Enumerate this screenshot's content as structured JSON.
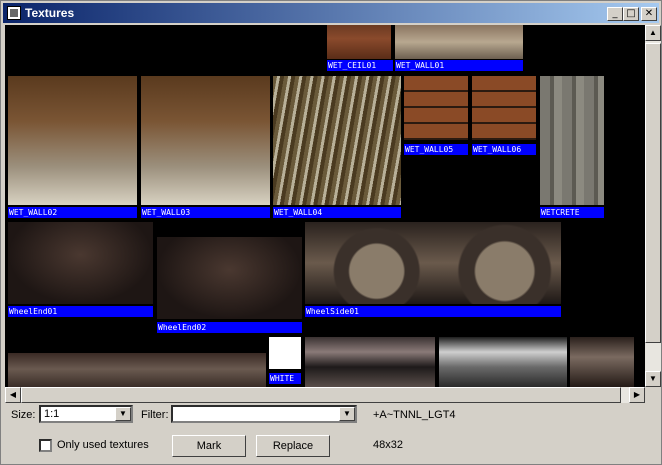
{
  "window": {
    "title": "Textures",
    "min_label": "_",
    "max_label": "□",
    "close_label": "✕"
  },
  "textures": [
    {
      "id": "wet_ceil01",
      "label": "WET_CEIL01",
      "bg": "linear-gradient(180deg,#6b3a22,#8a4a2c 40%,#5a2d18)"
    },
    {
      "id": "wet_wall01",
      "label": "WET_WALL01",
      "bg": "linear-gradient(180deg,#8a7560,#b8a890 50%,#6d6050)"
    },
    {
      "id": "wet_wall02",
      "label": "WET_WALL02",
      "bg": "linear-gradient(180deg,#5a3a1e,#7a5534 35%,#9b8f7c 70%,#d8d2c2)"
    },
    {
      "id": "wet_wall03",
      "label": "WET_WALL03",
      "bg": "linear-gradient(180deg,#5a3a1e,#7a5534 35%,#9b8f7c 70%,#d8d2c2)"
    },
    {
      "id": "wet_wall04",
      "label": "WET_WALL04",
      "bg": "repeating-linear-gradient(100deg,#6a5a3a 0 4px,#b8b098 4px 7px,#4a3a20 7px 11px)"
    },
    {
      "id": "wet_wall05",
      "label": "WET_WALL05",
      "bg": "repeating-linear-gradient(0deg,#2a1a10 0 2px,#8a4a26 2px 16px)"
    },
    {
      "id": "wet_wall06",
      "label": "WET_WALL06",
      "bg": "repeating-linear-gradient(0deg,#2a1a10 0 2px,#8a4a26 2px 16px)"
    },
    {
      "id": "wetcrete",
      "label": "WETCRETE",
      "bg": "repeating-linear-gradient(90deg,#7a7870 0 10px,#5c5a52 10px 14px,#8c8a80 14px 22px)"
    },
    {
      "id": "wheelend01",
      "label": "WheelEnd01",
      "bg": "radial-gradient(ellipse at 50% 40%,#4a3830,#1e1614 70%)"
    },
    {
      "id": "wheelend02",
      "label": "WheelEnd02",
      "bg": "radial-gradient(ellipse at 50% 40%,#4a3830,#1e1614 70%)"
    },
    {
      "id": "wheelside01",
      "label": "WheelSide01",
      "bg": "radial-gradient(circle at 28% 60%,#8a7c6a 0 14%,#3a302a 15% 22%,transparent 23%),radial-gradient(circle at 78% 60%,#8a7c6a 0 14%,#3a302a 15% 22%,transparent 23%),linear-gradient(180deg,#2a221e,#6a5a4c 50%,#1e1816)"
    },
    {
      "id": "white",
      "label": "WHITE",
      "bg": "#ffffff"
    }
  ],
  "partial_tiles": [
    {
      "id": "row4-a",
      "bg": "linear-gradient(180deg,#3a2a24,#6a5a50 40%,#2a1e1a)"
    },
    {
      "id": "row4-b",
      "bg": "linear-gradient(180deg,#3a3232,#8a7a78 30%,#1e1a1a 60%,#5a4e4a)"
    },
    {
      "id": "row4-c",
      "bg": "linear-gradient(180deg,#1e1e1e,#cfcfcf 30%,#6a6a6a 60%,#2a2a2a)"
    },
    {
      "id": "row4-d",
      "bg": "linear-gradient(180deg,#2a201c,#7a6a60 40%,#241a16)"
    }
  ],
  "controls": {
    "size_label": "Size:",
    "size_value": "1:1",
    "filter_label": "Filter:",
    "filter_value": "",
    "texture_name": "+A~TNNL_LGT4",
    "only_used_label": "Only used textures",
    "mark_label": "Mark",
    "replace_label": "Replace",
    "dimensions": "48x32"
  },
  "scroll_arrows": {
    "up": "▲",
    "down": "▼",
    "left": "◀",
    "right": "▶",
    "dropdown": "▼"
  }
}
